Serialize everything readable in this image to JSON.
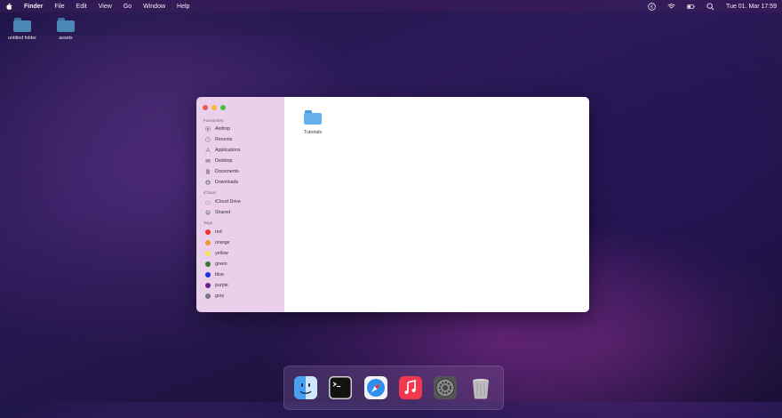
{
  "menubar": {
    "app_name": "Finder",
    "menus": [
      "File",
      "Edit",
      "View",
      "Go",
      "Window",
      "Help"
    ],
    "clock": "Tue 01. Mar 17:59",
    "status_icons": [
      "euro-icon",
      "wifi-icon",
      "battery-icon",
      "search-icon"
    ]
  },
  "desktop": {
    "icons": [
      {
        "label": "untitled folder",
        "icon": "folder-icon"
      },
      {
        "label": "assets",
        "icon": "folder-icon"
      }
    ]
  },
  "finder": {
    "sidebar": {
      "favourites_title": "Favourites",
      "favourites": [
        {
          "label": "Airdrop",
          "icon": "airdrop-icon"
        },
        {
          "label": "Recents",
          "icon": "clock-icon"
        },
        {
          "label": "Applications",
          "icon": "applications-icon"
        },
        {
          "label": "Desktop",
          "icon": "desktop-icon"
        },
        {
          "label": "Documents",
          "icon": "document-icon"
        },
        {
          "label": "Downloads",
          "icon": "download-icon"
        }
      ],
      "icloud_title": "iCloud",
      "icloud": [
        {
          "label": "iCloud Drive",
          "icon": "cloud-icon"
        },
        {
          "label": "Shared",
          "icon": "shared-icon"
        }
      ],
      "tags_title": "Tags",
      "tags": [
        {
          "label": "red",
          "color": "#e8352b"
        },
        {
          "label": "orange",
          "color": "#f2962a"
        },
        {
          "label": "yellow",
          "color": "#f6e05a"
        },
        {
          "label": "green",
          "color": "#2f7a2f"
        },
        {
          "label": "blue",
          "color": "#1b2fd6"
        },
        {
          "label": "purple",
          "color": "#6b1f8c"
        },
        {
          "label": "grey",
          "color": "#7a7a7a"
        }
      ]
    },
    "content": {
      "items": [
        {
          "label": "Tutorials",
          "icon": "folder-icon"
        }
      ]
    }
  },
  "dock": {
    "apps": [
      "finder-icon",
      "terminal-icon",
      "safari-icon",
      "music-icon",
      "system-preferences-icon",
      "trash-icon"
    ]
  }
}
